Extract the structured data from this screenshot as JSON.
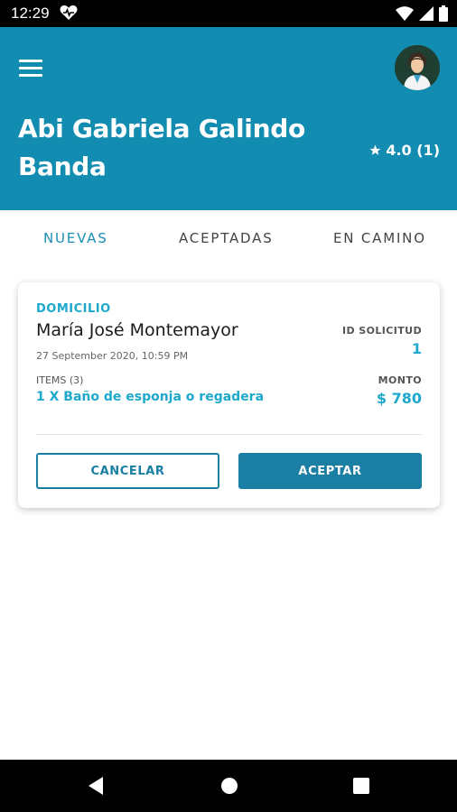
{
  "status_bar": {
    "time": "12:29"
  },
  "header": {
    "user_name": "Abi Gabriela Galindo Banda",
    "rating": "4.0 (1)",
    "accent_color": "#138cb2"
  },
  "tabs": [
    {
      "label": "NUEVAS",
      "active": true
    },
    {
      "label": "ACEPTADAS",
      "active": false
    },
    {
      "label": "EN CAMINO",
      "active": false
    }
  ],
  "request": {
    "type": "DOMICILIO",
    "client": "María José Montemayor",
    "date": "27 September 2020, 10:59 PM",
    "id_label": "ID SOLICITUD",
    "id_value": "1",
    "items_label": "ITEMS (3)",
    "item": "1 X Baño de esponja o regadera",
    "amount_label": "MONTO",
    "amount_value": "$ 780",
    "cancel_label": "CANCELAR",
    "accept_label": "ACEPTAR"
  },
  "icons": {
    "menu": "hamburger-menu-icon",
    "star": "star-icon",
    "back": "back-triangle-icon",
    "home": "home-circle-icon",
    "recents": "recents-square-icon"
  }
}
